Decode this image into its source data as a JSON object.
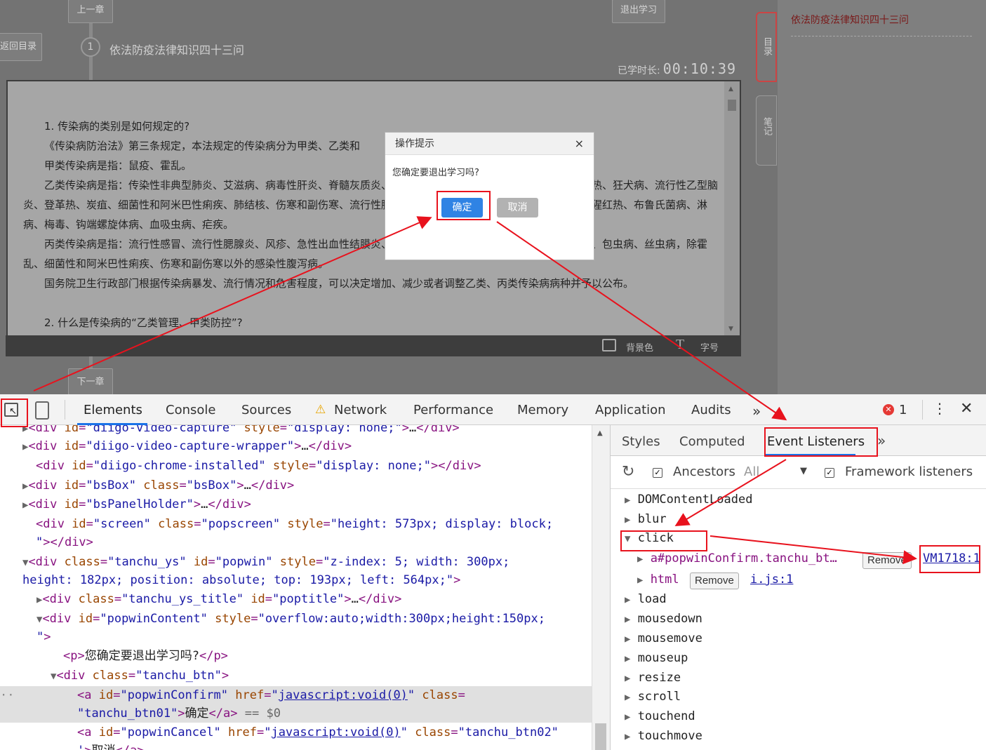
{
  "page": {
    "prev_chapter": "上一章",
    "next_chapter": "下一章",
    "exit_study": "退出学习",
    "back_catalog": "返回目录",
    "chapter_number": "1",
    "chapter_title": "依法防疫法律知识四十三问",
    "study_time_label": "已学时长:",
    "study_time_value": "00:10:39",
    "paragraphs": [
      "1. 传染病的类别是如何规定的?",
      "《传染病防治法》第三条规定，本法规定的传染病分为甲类、乙类和",
      "甲类传染病是指：鼠疫、霍乱。",
      "乙类传染病是指：传染性非典型肺炎、艾滋病、病毒性肝炎、脊髓灰质炎、人感染高致病性禽流感、麻疹、流行性出血热、狂犬病、流行性乙型脑炎、登革热、炭疽、细菌性和阿米巴性痢疾、肺结核、伤寒和副伤寒、流行性脑脊髓膜炎、百日咳、白喉、新生儿破伤风、猩红热、布鲁氏菌病、淋病、梅毒、钩端螺旋体病、血吸虫病、疟疾。",
      "丙类传染病是指：流行性感冒、流行性腮腺炎、风疹、急性出血性结膜炎、麻风病、流行性和地方性斑疹伤寒、黑热病、包虫病、丝虫病，除霍乱、细菌性和阿米巴性痢疾、伤寒和副伤寒以外的感染性腹泻病。",
      "国务院卫生行政部门根据传染病暴发、流行情况和危害程度，可以决定增加、减少或者调整乙类、丙类传染病病种并予以公布。",
      "",
      "2. 什么是传染病的“乙类管理、甲类防控”?"
    ],
    "toolbar_bg": "背景色",
    "toolbar_font": "字号",
    "side_tab_catalog": "目录",
    "side_tab_notes": "笔记",
    "side_link": "依法防疫法律知识四十三问"
  },
  "modal": {
    "title": "操作提示",
    "close": "×",
    "message": "您确定要退出学习吗?",
    "confirm": "确定",
    "cancel": "取消"
  },
  "devtools": {
    "tabs": [
      "Elements",
      "Console",
      "Sources",
      "Network",
      "Performance",
      "Memory",
      "Application",
      "Audits"
    ],
    "more": "»",
    "error_count": "1",
    "warning_icon": "warning-icon",
    "side_tabs": [
      "Styles",
      "Computed",
      "Event Listeners"
    ],
    "ancestors_label": "Ancestors",
    "all_label": "All",
    "framework_label": "Framework listeners",
    "events": [
      "DOMContentLoaded",
      "blur",
      "click",
      "load",
      "mousedown",
      "mousemove",
      "mouseup",
      "resize",
      "scroll",
      "touchend",
      "touchmove"
    ],
    "click_children": [
      {
        "target": "a#popwinConfirm.tanchu_bt…",
        "remove": "Remove",
        "source": "VM1718:1"
      },
      {
        "target": "html",
        "remove": "Remove",
        "source": "i.js:1"
      }
    ]
  },
  "colors": {
    "highlight_red": "#e8121d",
    "confirm_blue": "#2f83e4"
  }
}
